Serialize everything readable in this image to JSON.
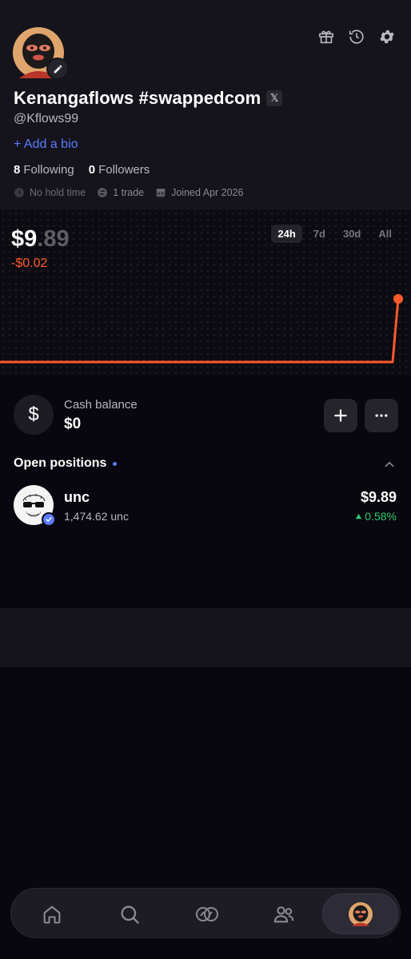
{
  "profile": {
    "display_name": "Kenangaflows #swappedcom",
    "x_badge": "𝕏",
    "handle": "@Kflows99",
    "add_bio": "+ Add a bio",
    "following_count": "8",
    "following_label": "Following",
    "followers_count": "0",
    "followers_label": "Followers",
    "hold_time": "No hold time",
    "trades": "1 trade",
    "joined": "Joined Apr 2026"
  },
  "portfolio": {
    "balance_whole": "$9",
    "balance_cents": ".89",
    "change": "-$0.02",
    "ranges": [
      "24h",
      "7d",
      "30d",
      "All"
    ],
    "active_range": "24h"
  },
  "chart_data": {
    "type": "line",
    "x": [
      0,
      1,
      2,
      3,
      4,
      5,
      6,
      7,
      8,
      9,
      10,
      11,
      12,
      13,
      14,
      15,
      16,
      17,
      18,
      19,
      20
    ],
    "series": [
      {
        "values": [
          9.87,
          9.87,
          9.87,
          9.87,
          9.87,
          9.87,
          9.87,
          9.87,
          9.87,
          9.87,
          9.87,
          9.87,
          9.87,
          9.87,
          9.87,
          9.87,
          9.87,
          9.87,
          9.87,
          9.87,
          9.89
        ]
      }
    ],
    "title": "",
    "xlabel": "",
    "ylabel": "",
    "line_color": "#ff5a2c"
  },
  "cash": {
    "label": "Cash balance",
    "value": "$0",
    "icon": "$"
  },
  "positions": {
    "title": "Open positions",
    "items": [
      {
        "name": "unc",
        "amount": "1,474.62 unc",
        "value": "$9.89",
        "change": "0.58%"
      }
    ]
  },
  "nav": {
    "items": [
      "home-icon",
      "search-icon",
      "trade-icon",
      "friends-icon",
      "profile-avatar"
    ],
    "active": "profile-avatar"
  },
  "colors": {
    "accent_orange": "#ff5a2c",
    "accent_blue": "#5b7cff",
    "positive_green": "#2ecc71",
    "background": "#08070f"
  }
}
